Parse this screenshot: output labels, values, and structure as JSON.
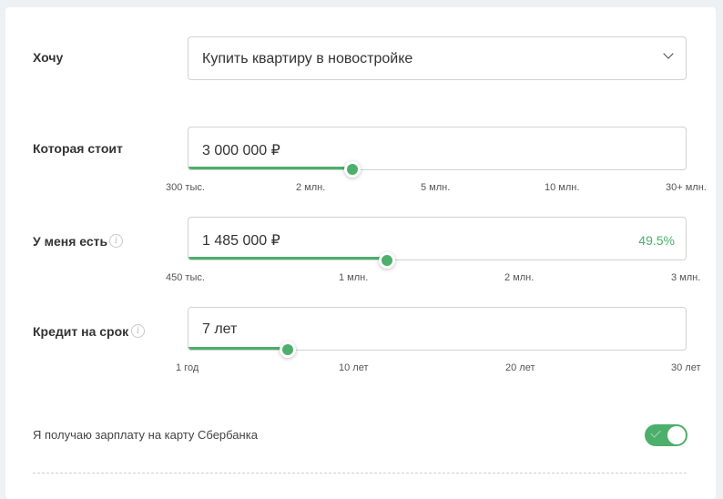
{
  "want": {
    "label": "Хочу",
    "selected": "Купить квартиру в новостройке"
  },
  "price": {
    "label": "Которая стоит",
    "value": "3 000 000 ₽",
    "fill_percent": 33,
    "ticks": [
      "300 тыс.",
      "2 млн.",
      "5 млн.",
      "10 млн.",
      "30+ млн."
    ]
  },
  "downpayment": {
    "label": "У меня есть",
    "value": "1 485 000 ₽",
    "percent": "49.5%",
    "fill_percent": 40,
    "ticks": [
      "450 тыс.",
      "1 млн.",
      "2 млн.",
      "3 млн."
    ]
  },
  "term": {
    "label": "Кредит на срок",
    "value": "7 лет",
    "fill_percent": 20,
    "ticks": [
      "1 год",
      "10 лет",
      "20 лет",
      "30 лет"
    ]
  },
  "salary": {
    "label": "Я получаю зарплату на карту Сбербанка",
    "checked": true
  },
  "colors": {
    "accent": "#4caf6b",
    "border": "#d2d2d2"
  },
  "icons": {
    "info": "info-icon",
    "dropdown": "chevron-down-icon",
    "toggle_check": "check-icon"
  }
}
